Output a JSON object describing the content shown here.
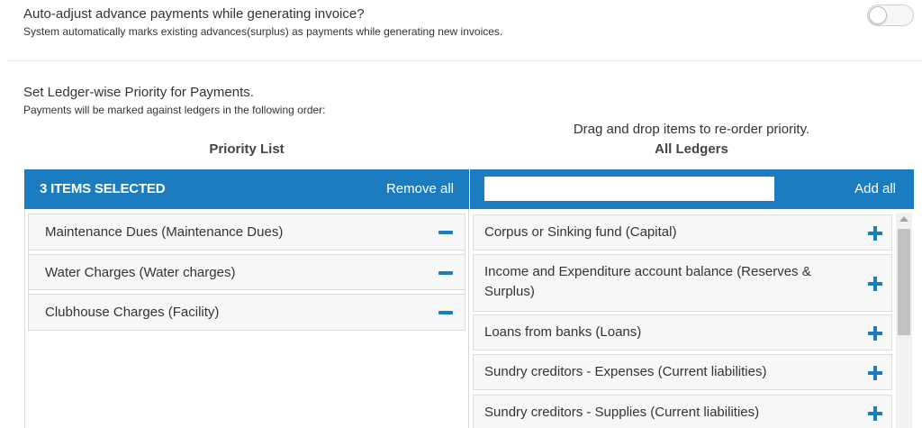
{
  "advance": {
    "title": "Auto-adjust advance payments while generating invoice?",
    "subtitle": "System automatically marks existing advances(surplus) as payments while generating new invoices.",
    "toggle_on": false
  },
  "priority": {
    "title": "Set Ledger-wise Priority for Payments.",
    "subtitle": "Payments will be marked against ledgers in the following order:",
    "drag_hint": "Drag and drop items to re-order priority."
  },
  "priority_list": {
    "title": "Priority List",
    "selected_count": "3 ITEMS SELECTED",
    "remove_all_label": "Remove all",
    "items": [
      {
        "label": "Maintenance Dues (Maintenance Dues)"
      },
      {
        "label": "Water Charges (Water charges)"
      },
      {
        "label": "Clubhouse Charges (Facility)"
      }
    ]
  },
  "all_ledgers": {
    "title": "All Ledgers",
    "add_all_label": "Add all",
    "search_value": "",
    "search_placeholder": "",
    "items": [
      {
        "label": "Corpus or Sinking fund (Capital)"
      },
      {
        "label": "Income and Expenditure account balance (Reserves & Surplus)"
      },
      {
        "label": "Loans from banks (Loans)"
      },
      {
        "label": "Sundry creditors - Expenses (Current liabilities)"
      },
      {
        "label": "Sundry creditors - Supplies (Current liabilities)"
      }
    ]
  },
  "colors": {
    "accent": "#1b7dbf",
    "item_bg": "#f7f7f7",
    "border": "#dcdcdc"
  },
  "icons": {
    "remove": "minus-icon",
    "add": "plus-icon",
    "scroll_up": "chevron-up-icon"
  }
}
